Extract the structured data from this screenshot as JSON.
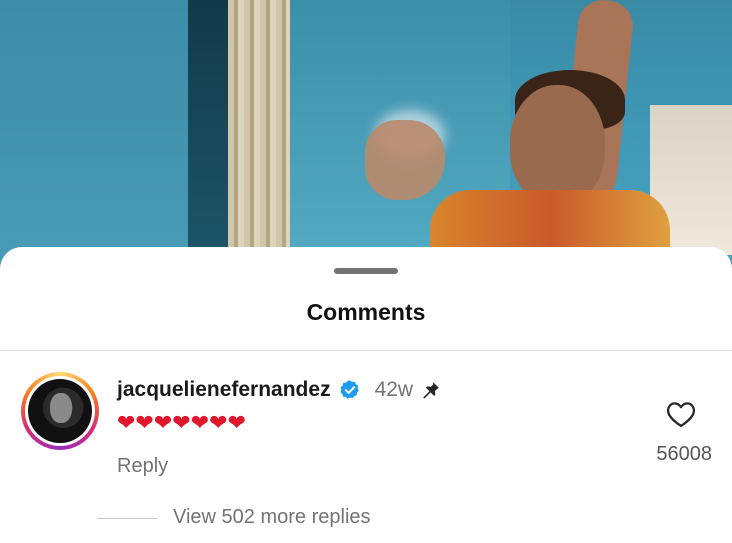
{
  "sheet": {
    "title": "Comments"
  },
  "comment": {
    "username": "jacquelienefernandez",
    "verified": true,
    "age": "42w",
    "pinned": true,
    "text": "❤❤❤❤❤❤❤",
    "reply_label": "Reply",
    "like_count": "56008",
    "view_replies": "View 502 more replies"
  },
  "icons": {
    "verified": "verified-badge-icon",
    "pin": "pin-icon",
    "like": "heart-outline-icon"
  },
  "colors": {
    "verified_blue": "#1d9bf0",
    "heart_red": "#e0172c",
    "muted_text": "#737373"
  }
}
